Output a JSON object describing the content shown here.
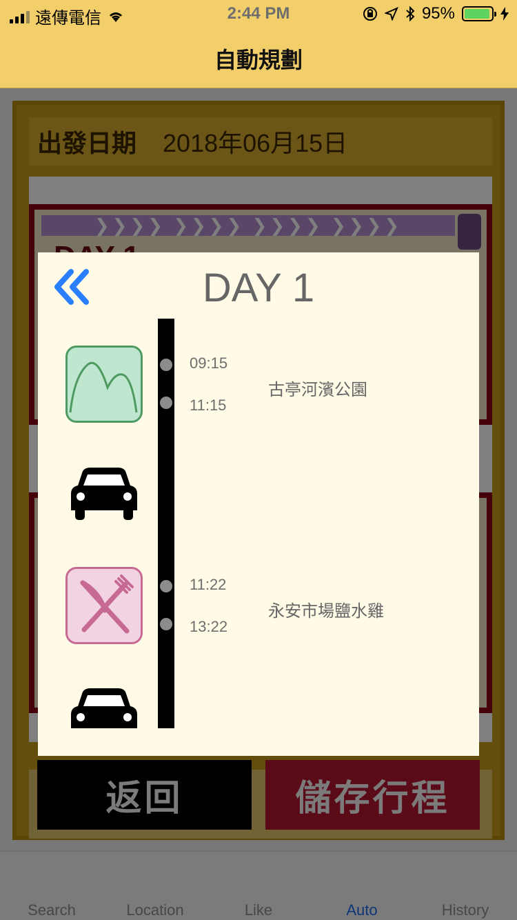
{
  "status_bar": {
    "carrier": "遠傳電信",
    "time": "2:44 PM",
    "battery_percent": "95%",
    "icons": [
      "signal-icon",
      "wifi-icon",
      "orientation-lock-icon",
      "location-icon",
      "bluetooth-icon",
      "battery-icon",
      "charging-icon"
    ]
  },
  "nav": {
    "title": "自動規劃"
  },
  "background": {
    "date_label": "出發日期",
    "date_value": "2018年06月15日",
    "day_card_label": "DAY 1",
    "stripe_text": "❯❯❯❯     ❯❯❯❯     ❯❯❯❯     ❯❯❯❯"
  },
  "modal": {
    "title": "DAY 1",
    "items": [
      {
        "type": "attraction",
        "icon": "mountain-icon",
        "start": "09:15",
        "end": "11:15",
        "name": "古亭河濱公園"
      },
      {
        "type": "transport",
        "icon": "car-icon"
      },
      {
        "type": "restaurant",
        "icon": "fork-knife-icon",
        "start": "11:22",
        "end": "13:22",
        "name": "永安市場鹽水雞"
      },
      {
        "type": "transport",
        "icon": "car-icon"
      }
    ]
  },
  "buttons": {
    "back": "返回",
    "save": "儲存行程"
  },
  "tabs": [
    {
      "label": "Search"
    },
    {
      "label": "Location"
    },
    {
      "label": "Like"
    },
    {
      "label": "Auto"
    },
    {
      "label": "History"
    }
  ],
  "colors": {
    "header": "#f2cf6b",
    "modal_bg": "#fffbe6",
    "accent_blue": "#2a7fff",
    "mountain_green": "#4e9a60",
    "fork_pink": "#c66a94",
    "save_button": "#5b0a18"
  }
}
